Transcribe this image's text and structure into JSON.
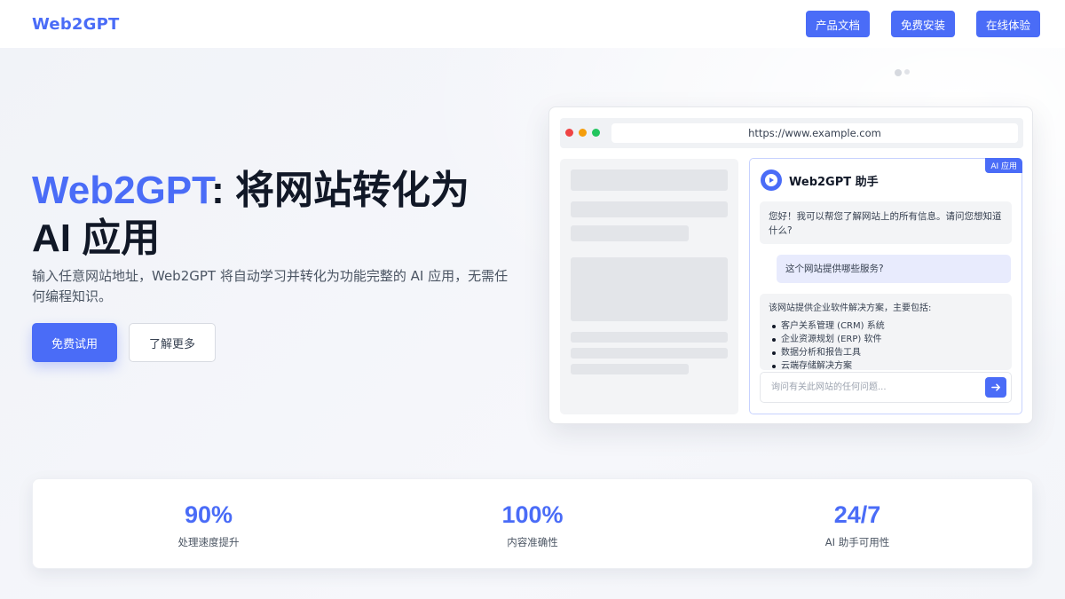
{
  "nav": {
    "brand": "Web2GPT",
    "buttons": [
      {
        "label": "产品文档"
      },
      {
        "label": "免费安装"
      },
      {
        "label": "在线体验"
      }
    ]
  },
  "hero": {
    "title_accent": "Web2GPT",
    "title_rest_line1": ": 将网站转化为",
    "title_line2": "AI 应用",
    "description": "输入任意网站地址，Web2GPT 将自动学习并转化为功能完整的 AI 应用，无需任何编程知识。",
    "primary_cta": "免费试用",
    "secondary_cta": "了解更多"
  },
  "browser": {
    "url": "https://www.example.com",
    "chat": {
      "badge": "AI 应用",
      "title": "Web2GPT 助手",
      "bot_greeting": "您好！我可以帮您了解网站上的所有信息。请问您想知道什么?",
      "user_question": "这个网站提供哪些服务?",
      "bot_answer_intro": "该网站提供企业软件解决方案，主要包括:",
      "bot_answer_items": [
        "客户关系管理 (CRM) 系统",
        "企业资源规划 (ERP) 软件",
        "数据分析和报告工具",
        "云端存储解决方案"
      ],
      "input_placeholder": "询问有关此网站的任何问题..."
    }
  },
  "stats": [
    {
      "value": "90%",
      "label": "处理速度提升"
    },
    {
      "value": "100%",
      "label": "内容准确性"
    },
    {
      "value": "24/7",
      "label": "AI 助手可用性"
    }
  ],
  "colors": {
    "accent": "#4a6cf7",
    "dot_red": "#ef4444",
    "dot_yellow": "#f59e0b",
    "dot_green": "#22c55e"
  },
  "icons": [
    "play-circle-icon",
    "arrow-right-icon"
  ]
}
